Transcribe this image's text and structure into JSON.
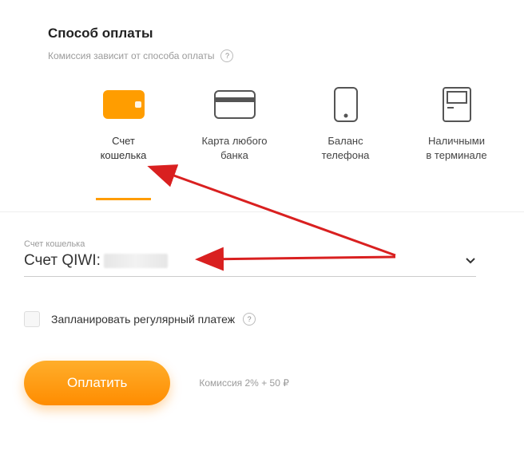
{
  "header": {
    "title": "Способ оплаты",
    "subtitle": "Комиссия зависит от способа оплаты",
    "help_glyph": "?"
  },
  "methods": [
    {
      "id": "wallet",
      "label": "Счет\nкошелька",
      "selected": true
    },
    {
      "id": "card",
      "label": "Карта любого\nбанка",
      "selected": false
    },
    {
      "id": "phone",
      "label": "Баланс\nтелефона",
      "selected": false
    },
    {
      "id": "terminal",
      "label": "Наличными\nв терминале",
      "selected": false
    }
  ],
  "account": {
    "label": "Счет кошелька",
    "prefix": "Счет QIWI:"
  },
  "schedule": {
    "label": "Запланировать регулярный платеж",
    "help_glyph": "?"
  },
  "pay": {
    "button": "Оплатить",
    "commission": "Комиссия 2% + 50 ₽"
  }
}
